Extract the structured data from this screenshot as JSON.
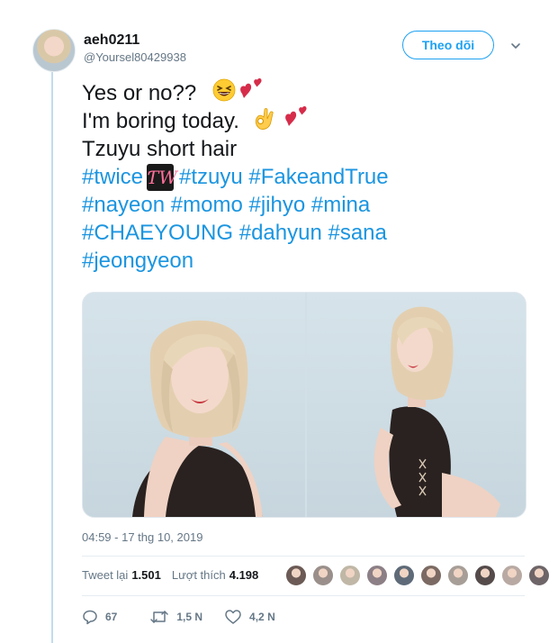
{
  "user": {
    "name": "aeh0211",
    "handle": "@Yoursel80429938",
    "follow_label": "Theo dõi"
  },
  "tweet": {
    "line1": "Yes or no??",
    "line2": "I'm boring today.",
    "line3": "Tzuyu short hair",
    "hashtags": {
      "twice": "#twice",
      "tzuyu": "#tzuyu",
      "fakeandtrue": "#FakeandTrue",
      "nayeon": "#nayeon",
      "momo": "#momo",
      "jihyo": "#jihyo",
      "mina": "#mina",
      "chaeyoung": "#CHAEYOUNG",
      "dahyun": "#dahyun",
      "sana": "#sana",
      "jeongyeon": "#jeongyeon"
    },
    "twice_logo_glyph": "ƬW"
  },
  "meta": {
    "timestamp": "04:59 - 17 thg 10, 2019"
  },
  "stats": {
    "retweets_label": "Tweet lại",
    "retweets_value": "1.501",
    "likes_label": "Lượt thích",
    "likes_value": "4.198"
  },
  "actions": {
    "reply_count": "67",
    "retweet_count": "1,5 N",
    "like_count": "4,2 N"
  },
  "colors": {
    "accent": "#1da1f2",
    "hashtag": "#1b95e0",
    "muted": "#657786"
  },
  "liker_colors": [
    "#6b5a55",
    "#9a8f8a",
    "#c0b7a6",
    "#8c7f86",
    "#5e6a78",
    "#7b6a63",
    "#a79e97",
    "#544b4a",
    "#b8a9a3",
    "#6e6568"
  ]
}
